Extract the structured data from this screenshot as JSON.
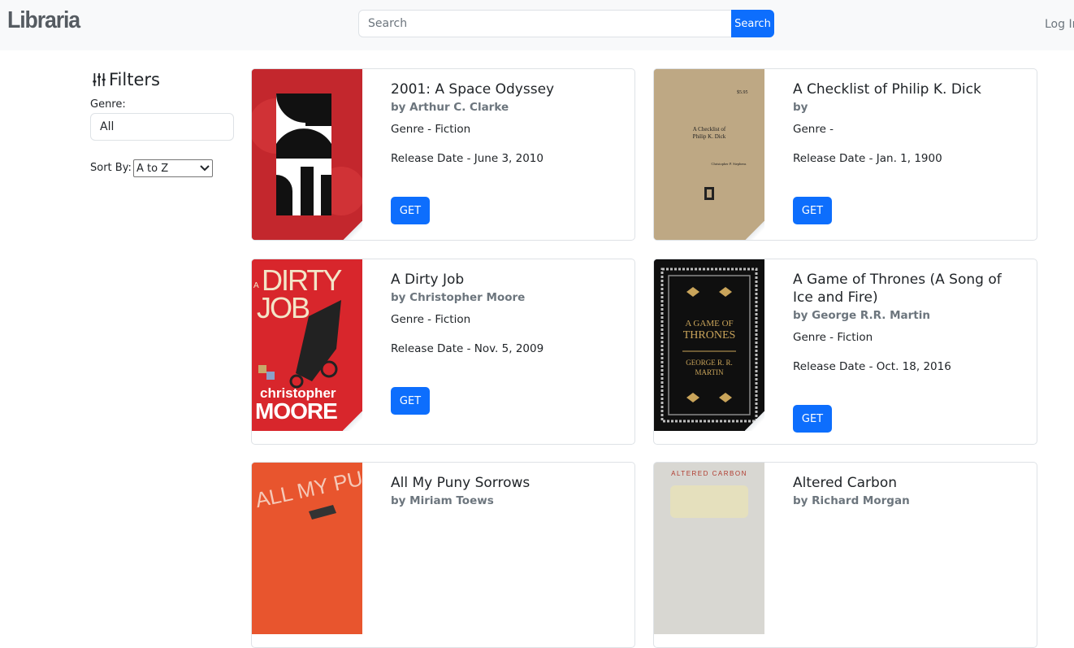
{
  "nav": {
    "brand": "Libraria",
    "search_placeholder": "Search",
    "search_button": "Search",
    "login": "Log In"
  },
  "filters": {
    "title": "Filters",
    "genre_label": "Genre:",
    "genre_value": "All",
    "sort_label": "Sort By:",
    "sort_value": "A to Z"
  },
  "colors": {
    "primary": "#0d6efd",
    "navbar_bg": "#f8f9fa",
    "muted": "#6c757d"
  },
  "books": [
    {
      "title": "2001: A Space Odyssey",
      "author": "by Arthur C. Clarke",
      "genre": "Genre - Fiction",
      "release": "Release Date - June 3, 2010",
      "button": "GET"
    },
    {
      "title": "A Checklist of Philip K. Dick",
      "author": "by",
      "genre": "Genre -",
      "release": "Release Date - Jan. 1, 1900",
      "button": "GET",
      "cover_text": "A Checklist of Philip K. Dick",
      "cover_author": "Christopher P. Stephens",
      "cover_price": "$5.95"
    },
    {
      "title": "A Dirty Job",
      "author": "by Christopher Moore",
      "genre": "Genre - Fiction",
      "release": "Release Date - Nov. 5, 2009",
      "button": "GET",
      "cover_top": "DIRTY",
      "cover_mid": "JOB",
      "cover_a": "A",
      "cover_author1": "christopher",
      "cover_author2": "MOORE"
    },
    {
      "title": "A Game of Thrones (A Song of Ice and Fire)",
      "author": "by George R.R. Martin",
      "genre": "Genre - Fiction",
      "release": "Release Date - Oct. 18, 2016",
      "button": "GET",
      "cover_text": "A GAME OF THRONES",
      "cover_author": "GEORGE R. R. MARTIN"
    },
    {
      "title": "All My Puny Sorrows",
      "author": "by Miriam Toews",
      "cover_text": "ALL MY PUNY"
    },
    {
      "title": "Altered Carbon",
      "author": "by Richard Morgan",
      "cover_text": "ALTERED CARBON"
    }
  ]
}
